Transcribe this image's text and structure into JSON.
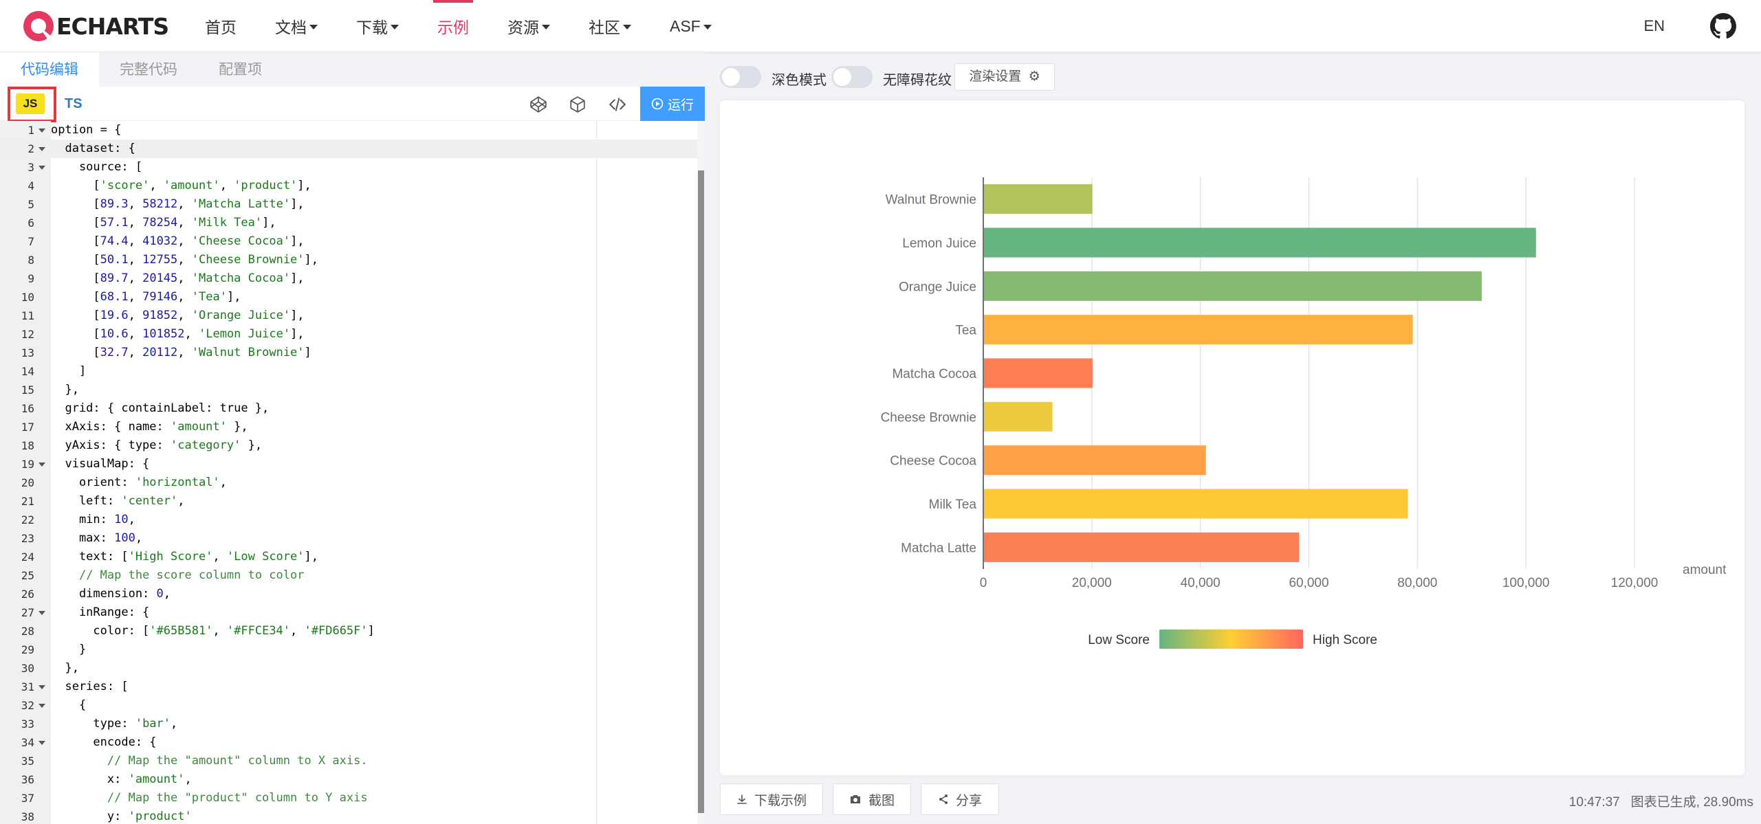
{
  "brand": {
    "name": "ECHARTS"
  },
  "nav": {
    "items": [
      {
        "label": "首页",
        "dropdown": false
      },
      {
        "label": "文档",
        "dropdown": true
      },
      {
        "label": "下载",
        "dropdown": true
      },
      {
        "label": "示例",
        "dropdown": false,
        "active": true
      },
      {
        "label": "资源",
        "dropdown": true
      },
      {
        "label": "社区",
        "dropdown": true
      },
      {
        "label": "ASF",
        "dropdown": true
      }
    ],
    "lang": "EN"
  },
  "editor": {
    "tabs": [
      "代码编辑",
      "完整代码",
      "配置项"
    ],
    "js_label": "JS",
    "ts_label": "TS",
    "run_label": "运行",
    "lines": [
      "option = {",
      "  dataset: {",
      "    source: [",
      "      ['score', 'amount', 'product'],",
      "      [89.3, 58212, 'Matcha Latte'],",
      "      [57.1, 78254, 'Milk Tea'],",
      "      [74.4, 41032, 'Cheese Cocoa'],",
      "      [50.1, 12755, 'Cheese Brownie'],",
      "      [89.7, 20145, 'Matcha Cocoa'],",
      "      [68.1, 79146, 'Tea'],",
      "      [19.6, 91852, 'Orange Juice'],",
      "      [10.6, 101852, 'Lemon Juice'],",
      "      [32.7, 20112, 'Walnut Brownie']",
      "    ]",
      "  },",
      "  grid: { containLabel: true },",
      "  xAxis: { name: 'amount' },",
      "  yAxis: { type: 'category' },",
      "  visualMap: {",
      "    orient: 'horizontal',",
      "    left: 'center',",
      "    min: 10,",
      "    max: 100,",
      "    text: ['High Score', 'Low Score'],",
      "    // Map the score column to color",
      "    dimension: 0,",
      "    inRange: {",
      "      color: ['#65B581', '#FFCE34', '#FD665F']",
      "    }",
      "  },",
      "  series: [",
      "    {",
      "      type: 'bar',",
      "      encode: {",
      "        // Map the \"amount\" column to X axis.",
      "        x: 'amount',",
      "        // Map the \"product\" column to Y axis",
      "        y: 'product'"
    ],
    "foldable": [
      1,
      2,
      3,
      19,
      27,
      31,
      32,
      34
    ]
  },
  "preview": {
    "dark_mode_label": "深色模式",
    "aria_label": "无障碍花纹",
    "render_settings_label": "渲染设置",
    "download_label": "下载示例",
    "screenshot_label": "截图",
    "share_label": "分享",
    "status_time": "10:47:37",
    "status_text": "图表已生成, 28.90ms"
  },
  "chart_data": {
    "type": "bar",
    "orientation": "horizontal",
    "categories": [
      "Matcha Latte",
      "Milk Tea",
      "Cheese Cocoa",
      "Cheese Brownie",
      "Matcha Cocoa",
      "Tea",
      "Orange Juice",
      "Lemon Juice",
      "Walnut Brownie"
    ],
    "values": [
      58212,
      78254,
      41032,
      12755,
      20145,
      79146,
      91852,
      101852,
      20112
    ],
    "scores": [
      89.3,
      57.1,
      74.4,
      50.1,
      89.7,
      68.1,
      19.6,
      10.6,
      32.7
    ],
    "xlabel": "amount",
    "xlim": [
      0,
      120000
    ],
    "xticks": [
      "0",
      "20,000",
      "40,000",
      "60,000",
      "80,000",
      "100,000",
      "120,000"
    ],
    "visual_map": {
      "min": 10,
      "max": 100,
      "low_text": "Low Score",
      "high_text": "High Score",
      "colors": [
        "#65B581",
        "#FFCE34",
        "#FD665F"
      ]
    },
    "grid": true,
    "legend_placement": "bottom-center"
  }
}
